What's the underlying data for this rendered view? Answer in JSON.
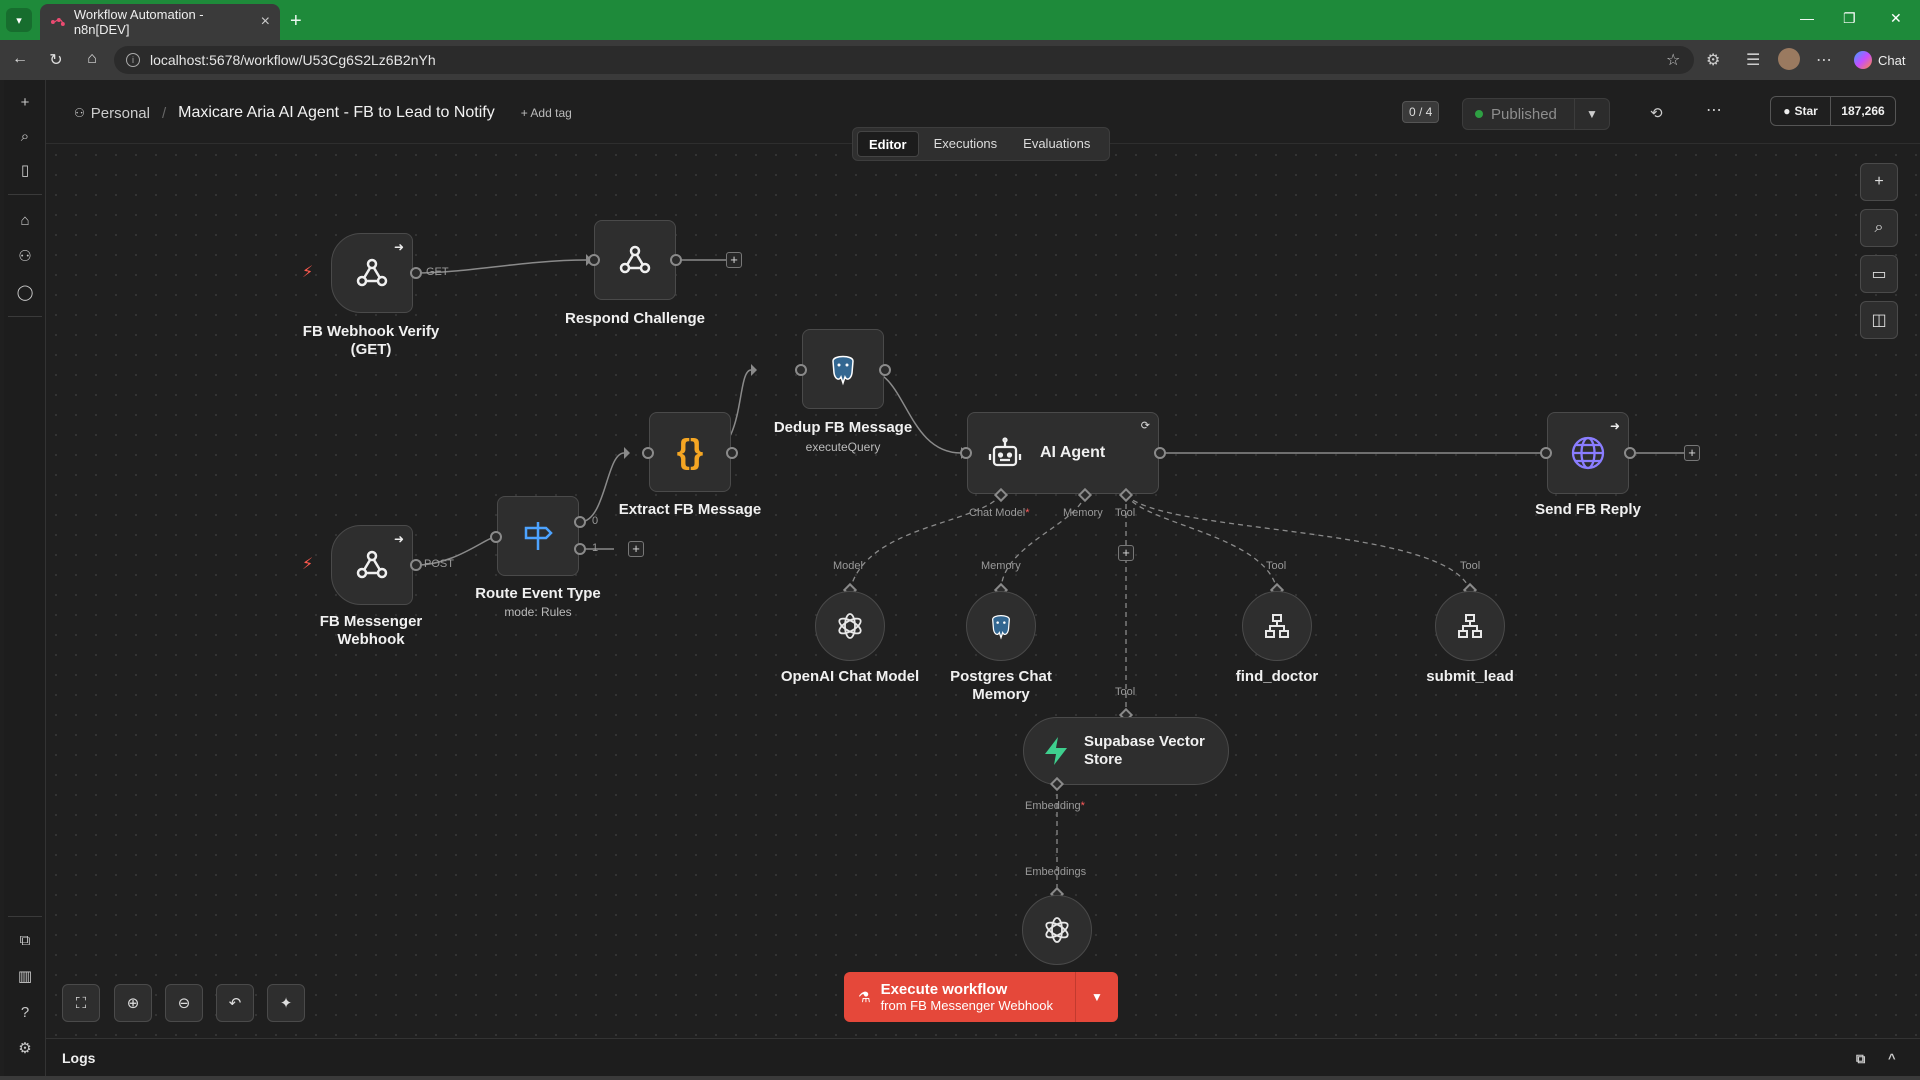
{
  "browser": {
    "tab_title": "Workflow Automation - n8n[DEV]",
    "url": "localhost:5678/workflow/U53Cg6S2Lz6B2nYh",
    "copilot_label": "Chat"
  },
  "header": {
    "project": "Personal",
    "workflow_name": "Maxicare Aria AI Agent - FB to Lead to Notify",
    "add_tag": "+ Add tag",
    "counter": "0 / 4",
    "publish_status": "Published",
    "github_star_label": "Star",
    "github_star_count": "187,266"
  },
  "mode_tabs": [
    {
      "label": "Editor",
      "active": true
    },
    {
      "label": "Executions",
      "active": false
    },
    {
      "label": "Evaluations",
      "active": false
    }
  ],
  "nodes": {
    "fb_webhook_verify": {
      "label": "FB Webhook Verify (GET)",
      "icon": "webhook-icon"
    },
    "respond_challenge": {
      "label": "Respond Challenge",
      "icon": "webhook-icon"
    },
    "fb_messenger_webhook": {
      "label": "FB Messenger Webhook",
      "icon": "webhook-icon"
    },
    "route_event_type": {
      "label": "Route Event Type",
      "sub": "mode: Rules",
      "icon": "signpost-icon"
    },
    "extract_fb_message": {
      "label": "Extract FB Message",
      "icon": "code-braces-icon"
    },
    "dedup_fb_message": {
      "label": "Dedup FB Message",
      "sub": "executeQuery",
      "icon": "postgres-icon"
    },
    "ai_agent": {
      "label": "AI Agent",
      "icon": "robot-icon"
    },
    "send_fb_reply": {
      "label": "Send FB Reply",
      "icon": "globe-icon"
    },
    "openai_chat_model": {
      "label": "OpenAI Chat Model",
      "icon": "openai-icon"
    },
    "postgres_chat_memory": {
      "label": "Postgres Chat Memory",
      "icon": "postgres-icon"
    },
    "find_doctor": {
      "label": "find_doctor",
      "icon": "workflow-tool-icon"
    },
    "submit_lead": {
      "label": "submit_lead",
      "icon": "workflow-tool-icon"
    },
    "supabase_vector_store": {
      "label": "Supabase Vector Store",
      "icon": "supabase-icon"
    },
    "embeddings_openai": {
      "label": "",
      "icon": "openai-icon"
    }
  },
  "edge_labels": {
    "get": "GET",
    "post": "POST",
    "out0": "0",
    "out1": "1",
    "chat_model": "Chat Model",
    "memory": "Memory",
    "tool": "Tool",
    "model": "Model",
    "embedding": "Embedding",
    "embeddings": "Embeddings",
    "required_mark": "*"
  },
  "execute": {
    "label": "Execute workflow",
    "sub": "from FB Messenger Webhook"
  },
  "logs": {
    "label": "Logs"
  },
  "colors": {
    "accent_red": "#e5483a",
    "browser_green": "#1e8a3a",
    "published_dot": "#2ea043",
    "code_orange": "#f5a623",
    "route_blue": "#4da3ff",
    "globe_purple": "#8a7dff",
    "supabase_green": "#3ecf8e"
  }
}
